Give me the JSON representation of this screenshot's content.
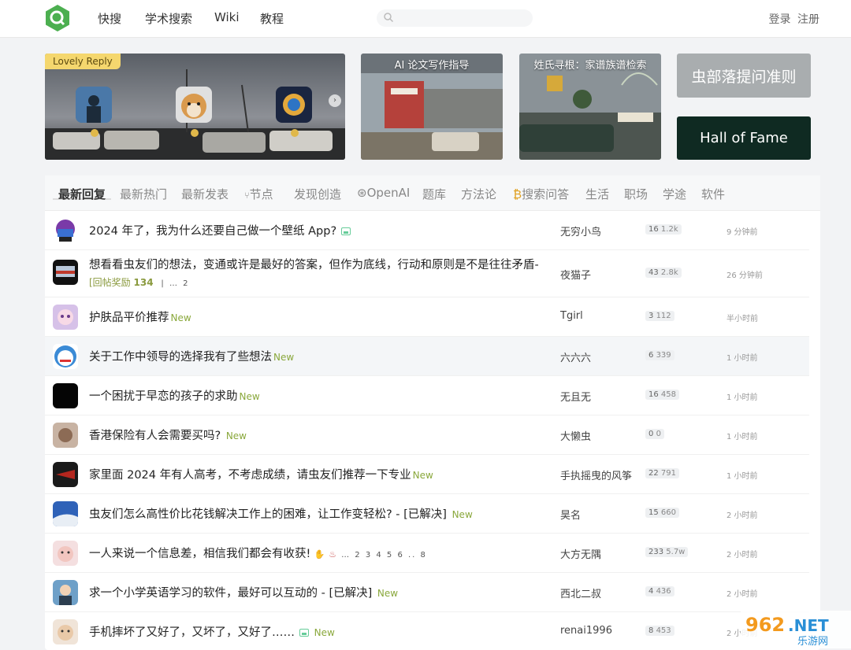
{
  "nav": {
    "links": [
      "快搜",
      "学术搜索",
      "Wiki",
      "教程"
    ],
    "search_placeholder": "",
    "login": "登录",
    "register": "注册"
  },
  "banners": {
    "lovely_reply": "Lovely Reply",
    "ai_writing": "AI 论文写作指导",
    "surname": "姓氏寻根：家谱族谱检索",
    "rules": "虫部落提问准则",
    "hall_of_fame": "Hall of Fame"
  },
  "tabs": [
    "最新回复",
    "最新热门",
    "最新发表",
    "节点",
    "发现创造",
    "OpenAI",
    "题库",
    "方法论",
    "搜索问答",
    "生活",
    "职场",
    "学途",
    "软件"
  ],
  "topics": [
    {
      "title": "2024 年了，我为什么还要自己做一个壁纸 App?",
      "author": "无穷小鸟",
      "replies": "16",
      "views": "1.2k",
      "time": "9 分钟前",
      "new": "",
      "img": true
    },
    {
      "title": "想看看虫友们的想法，变通或许是最好的答案，但作为底线，行动和原则是不是往往矛盾-",
      "sub_reward": "[回帖奖励",
      "sub_amount": "134",
      "sub_pages": "| … 2",
      "author": "夜猫子",
      "replies": "43",
      "views": "2.8k",
      "time": "26 分钟前",
      "new": ""
    },
    {
      "title": "护肤品平价推荐",
      "author": "Tgirl",
      "replies": "3",
      "views": "112",
      "time": "半小时前",
      "new": "New"
    },
    {
      "title": "关于工作中领导的选择我有了些想法",
      "author": "六六六",
      "replies": "6",
      "views": "339",
      "time": "1 小时前",
      "new": "New"
    },
    {
      "title": "一个困扰于早恋的孩子的求助",
      "author": "无且无",
      "replies": "16",
      "views": "458",
      "time": "1 小时前",
      "new": "New"
    },
    {
      "title": "香港保险有人会需要买吗?",
      "author": "大懒虫",
      "replies": "0",
      "views": "0",
      "time": "1 小时前",
      "new": "New"
    },
    {
      "title": "家里面 2024 年有人高考，不考虑成绩，请虫友们推荐一下专业",
      "author": "手执摇曳的风筝",
      "replies": "22",
      "views": "791",
      "time": "1 小时前",
      "new": "New"
    },
    {
      "title": "虫友们怎么高性价比花钱解决工作上的困难，让工作变轻松? - [已解决]",
      "author": "昊名",
      "replies": "15",
      "views": "660",
      "time": "2 小时前",
      "new": "New"
    },
    {
      "title": "一人来说一个信息差，相信我们都会有收获!",
      "pages": "… 2 3 4 5 6 .. 8",
      "author": "大方无隅",
      "replies": "233",
      "views": "5.7w",
      "time": "2 小时前",
      "new": ""
    },
    {
      "title": "求一个小学英语学习的软件，最好可以互动的 - [已解决]",
      "author": "西北二叔",
      "replies": "4",
      "views": "436",
      "time": "2 小时前",
      "new": "New"
    },
    {
      "title": "手机摔坏了又好了，又坏了，又好了……",
      "author": "renai1996",
      "replies": "8",
      "views": "453",
      "time": "2 小时前",
      "new": "New",
      "img": true
    }
  ],
  "watermark": "962.NET 乐游网",
  "colors": {
    "accent_green": "#8aa83c",
    "hof_bg": "#0f2a22",
    "rules_bg": "#a9adaf",
    "logo_green": "#4caf50"
  }
}
